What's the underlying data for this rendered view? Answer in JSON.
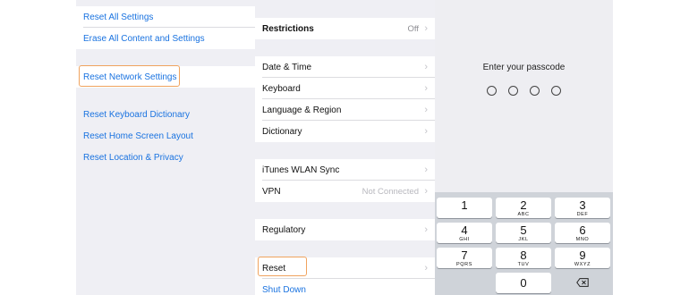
{
  "panel1": {
    "reset_all_settings": "Reset All Settings",
    "erase_all": "Erase All Content and Settings",
    "reset_network": "Reset Network Settings",
    "reset_keyboard_dictionary": "Reset Keyboard Dictionary",
    "reset_home_screen": "Reset Home Screen Layout",
    "reset_location_privacy": "Reset Location & Privacy"
  },
  "panel2": {
    "restrictions": {
      "label": "Restrictions",
      "value": "Off"
    },
    "date_time": "Date & Time",
    "keyboard": "Keyboard",
    "language_region": "Language & Region",
    "dictionary": "Dictionary",
    "itunes_wlan_sync": "iTunes WLAN Sync",
    "vpn": {
      "label": "VPN",
      "value": "Not Connected"
    },
    "regulatory": "Regulatory",
    "reset": "Reset",
    "shut_down": "Shut Down"
  },
  "passcode": {
    "title": "Enter your passcode",
    "keys": [
      {
        "num": "1",
        "letters": ""
      },
      {
        "num": "2",
        "letters": "ABC"
      },
      {
        "num": "3",
        "letters": "DEF"
      },
      {
        "num": "4",
        "letters": "GHI"
      },
      {
        "num": "5",
        "letters": "JKL"
      },
      {
        "num": "6",
        "letters": "MNO"
      },
      {
        "num": "7",
        "letters": "PQRS"
      },
      {
        "num": "8",
        "letters": "TUV"
      },
      {
        "num": "9",
        "letters": "WXYZ"
      },
      {
        "num": "0",
        "letters": ""
      }
    ]
  },
  "colors": {
    "link_blue": "#1a73e0",
    "highlight": "#f0a35e",
    "keypad_bg": "#cfd3d9"
  },
  "icons": {
    "chevron": "chevron-right-icon",
    "delete": "backspace-icon"
  }
}
